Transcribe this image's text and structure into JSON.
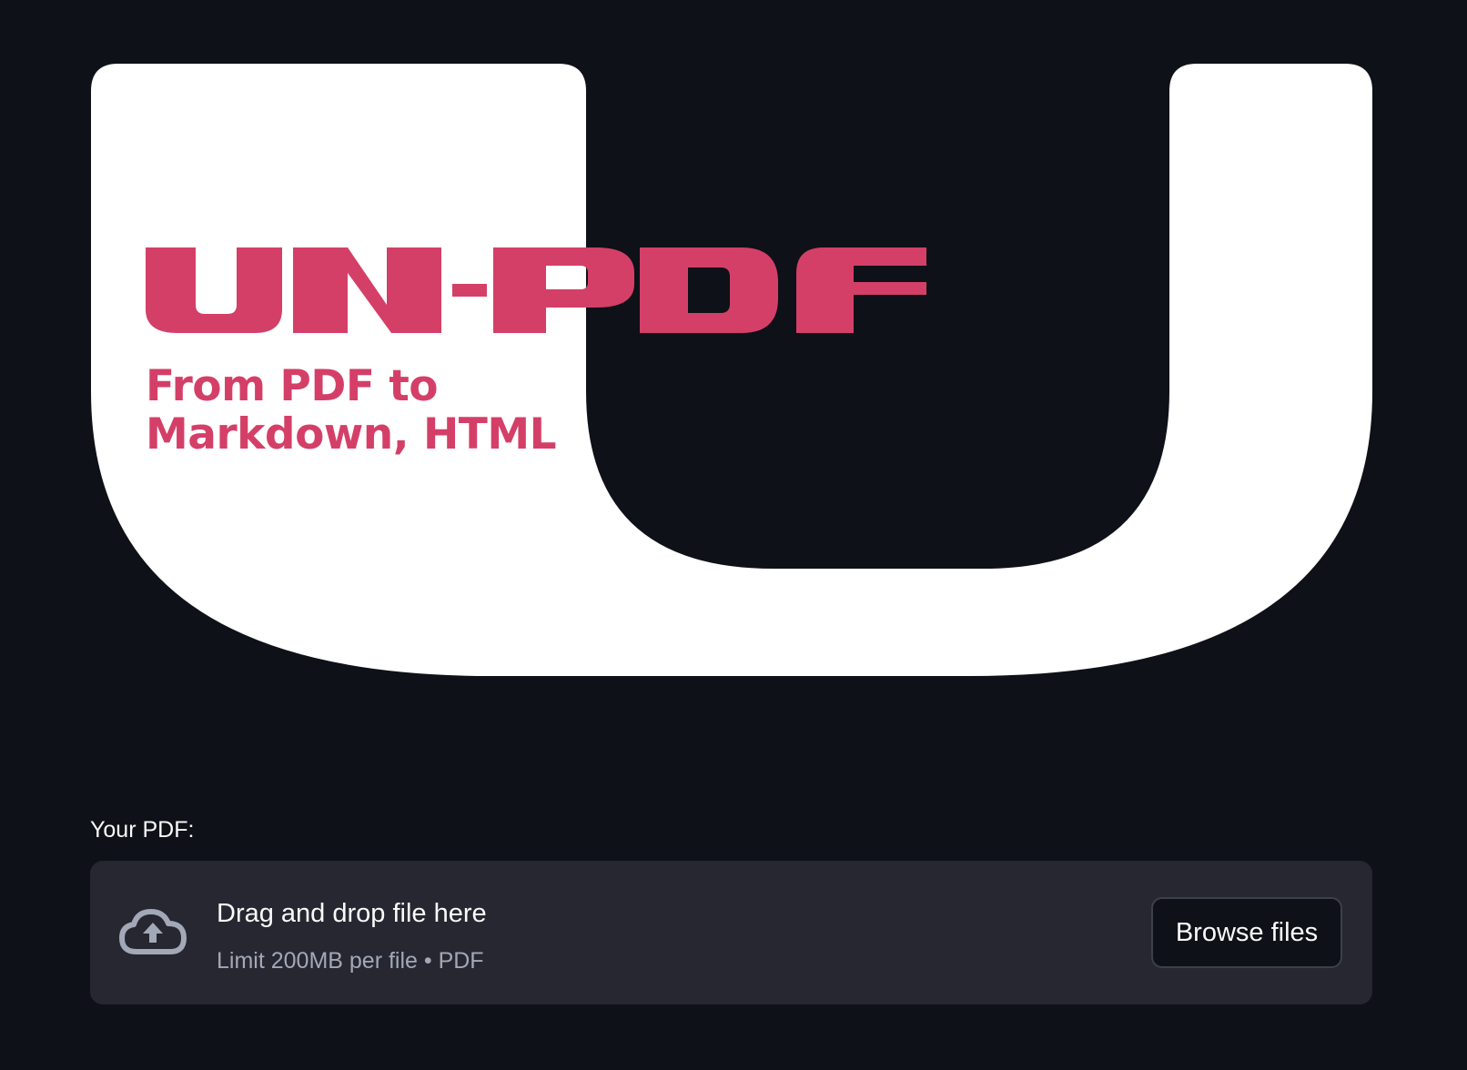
{
  "app": {
    "theme": {
      "background": "#0e1117",
      "panel": "#262730",
      "brand": "#d43f68",
      "logo_shape": "#ffffff",
      "text": "#fafafa",
      "muted_text": "#a3a8b8"
    }
  },
  "banner": {
    "logo_text": "UN-PDF",
    "tagline_line1": "From PDF to",
    "tagline_line2": "Markdown, HTML"
  },
  "uploader": {
    "label": "Your PDF:",
    "dropzone_title": "Drag and drop file here",
    "dropzone_hint": "Limit 200MB per file • PDF",
    "browse_button": "Browse files",
    "icon": "cloud-upload-icon"
  }
}
